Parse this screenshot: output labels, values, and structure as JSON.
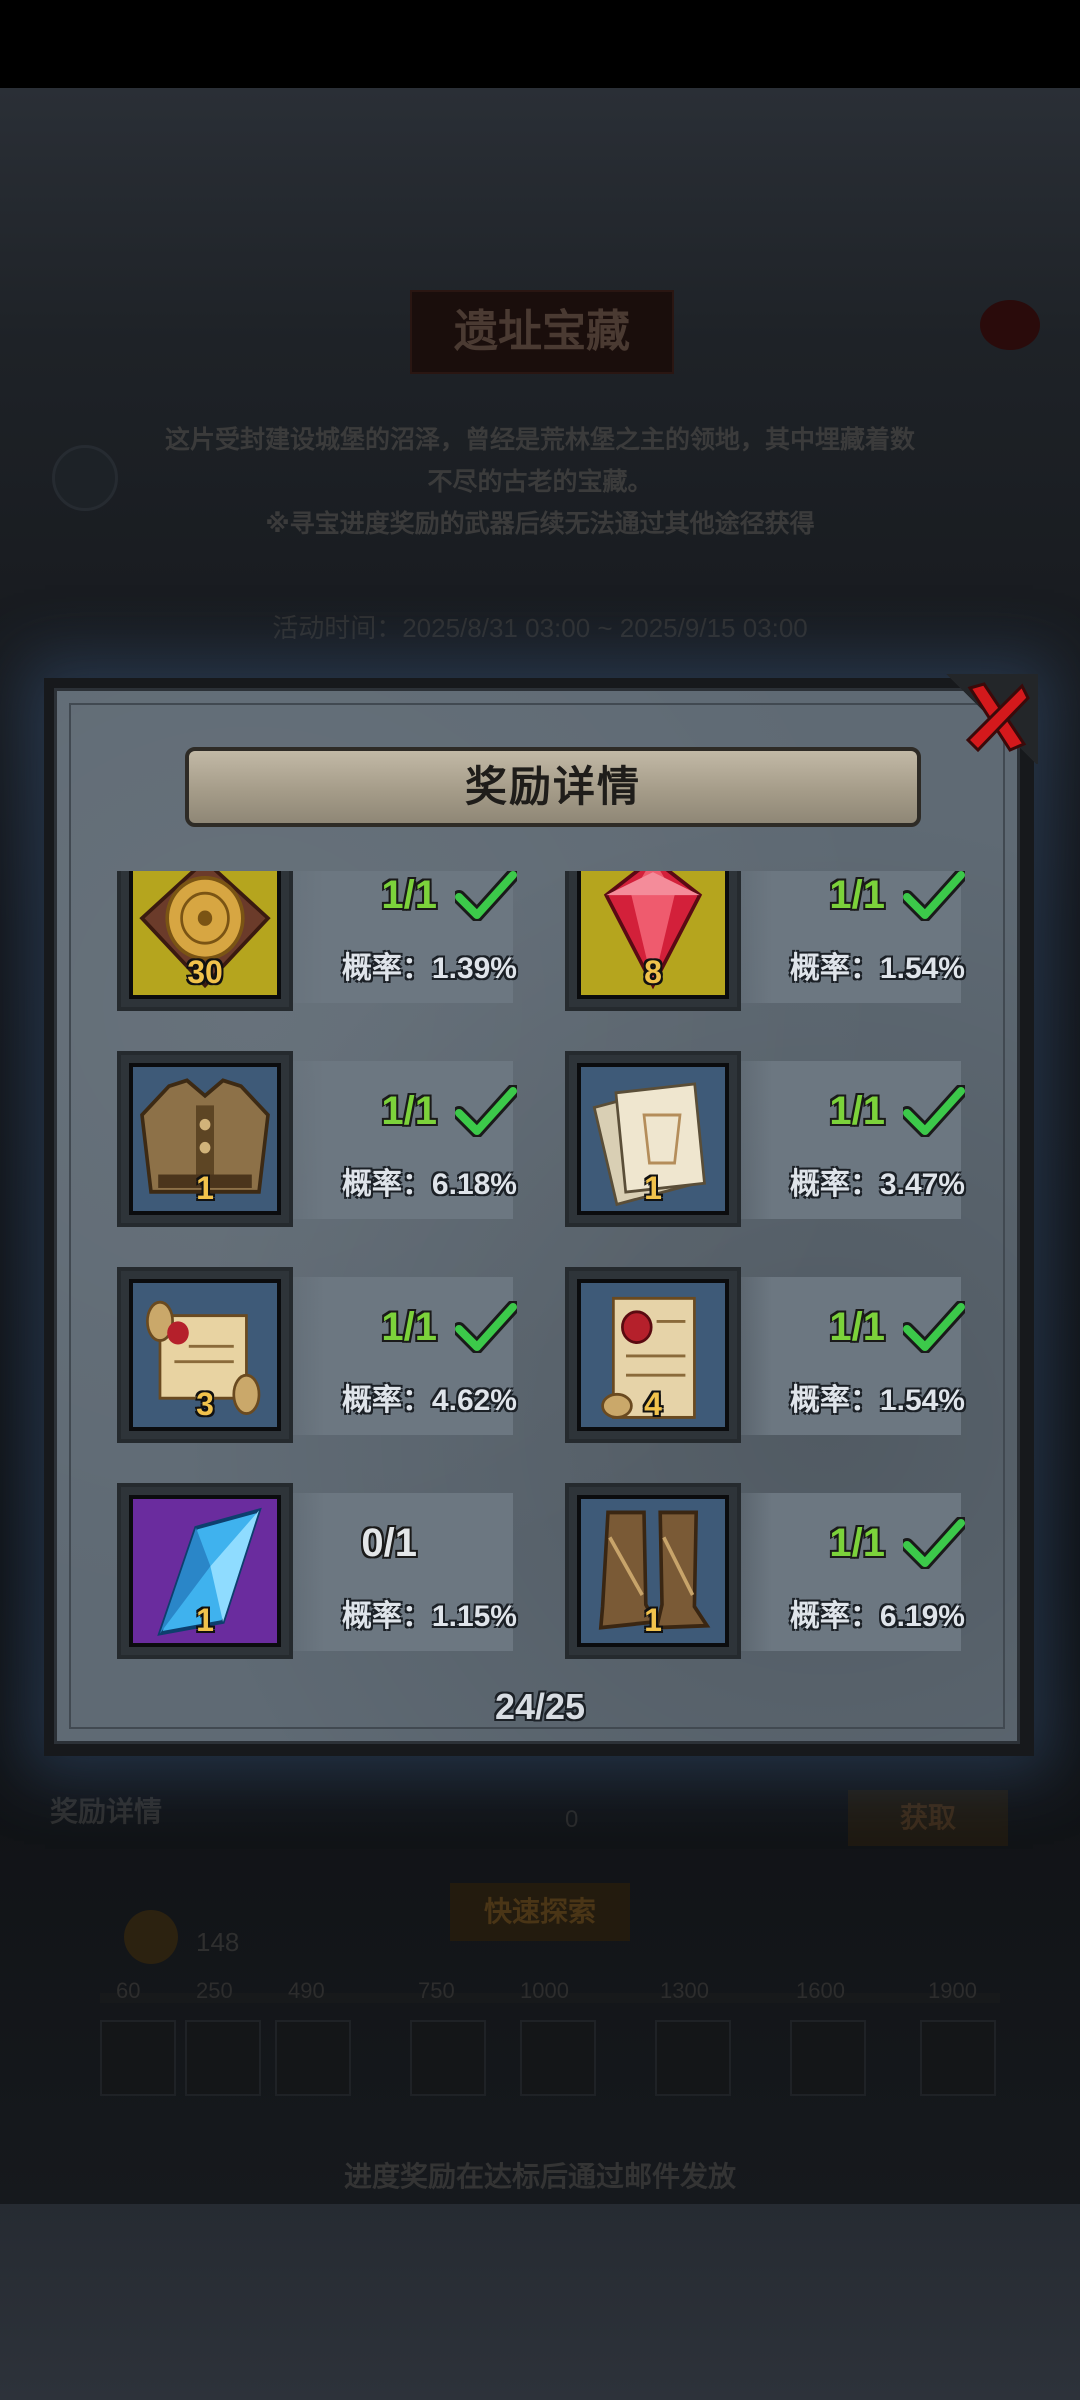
{
  "background": {
    "title": "遗址宝藏",
    "description_line1": "这片受封建设城堡的沼泽，曾经是荒林堡之主的领地，其中埋藏着数",
    "description_line2": "不尽的古老的宝藏。",
    "description_line3": "※寻宝进度奖励的武器后续无法通过其他途径获得",
    "event_time": "活动时间：2025/8/31 03:00 ~ 2025/9/15 03:00",
    "reward_details_label": "奖励详情",
    "zero_count": "0",
    "obtain_button": "获取",
    "quick_explore_button": "快速探索",
    "coin_count": "148",
    "milestones": [
      "60",
      "250",
      "490",
      "750",
      "1000",
      "1300",
      "1600",
      "1900"
    ],
    "footer_note": "进度奖励在达标后通过邮件发放"
  },
  "modal": {
    "title": "奖励详情",
    "counter": "24/25",
    "items": [
      {
        "icon": "gold-clock-tile-icon",
        "quantity": "30",
        "progress": "1/1",
        "completed": true,
        "probability": "概率：1.39%",
        "bg": "#b5a51e"
      },
      {
        "icon": "red-crystal-icon",
        "quantity": "8",
        "progress": "1/1",
        "completed": true,
        "probability": "概率：1.54%",
        "bg": "#b5a51e"
      },
      {
        "icon": "leather-armor-icon",
        "quantity": "1",
        "progress": "1/1",
        "completed": true,
        "probability": "概率：6.18%",
        "bg": "#3e5a78"
      },
      {
        "icon": "blueprint-papers-icon",
        "quantity": "1",
        "progress": "1/1",
        "completed": true,
        "probability": "概率：3.47%",
        "bg": "#3e5a78"
      },
      {
        "icon": "scroll-icon",
        "quantity": "3",
        "progress": "1/1",
        "completed": true,
        "probability": "概率：4.62%",
        "bg": "#3e5a78"
      },
      {
        "icon": "sealed-letter-icon",
        "quantity": "4",
        "progress": "1/1",
        "completed": true,
        "probability": "概率：1.54%",
        "bg": "#3e5a78"
      },
      {
        "icon": "blue-crystal-icon",
        "quantity": "1",
        "progress": "0/1",
        "completed": false,
        "probability": "概率：1.15%",
        "bg": "#6a2c9e"
      },
      {
        "icon": "leather-boots-icon",
        "quantity": "1",
        "progress": "1/1",
        "completed": true,
        "probability": "概率：6.19%",
        "bg": "#3e5a78"
      }
    ]
  },
  "colors": {
    "complete": "#7cd23b",
    "check": "#3cc94a",
    "close_x": "#d4191c",
    "quantity": "#f1c24c"
  }
}
